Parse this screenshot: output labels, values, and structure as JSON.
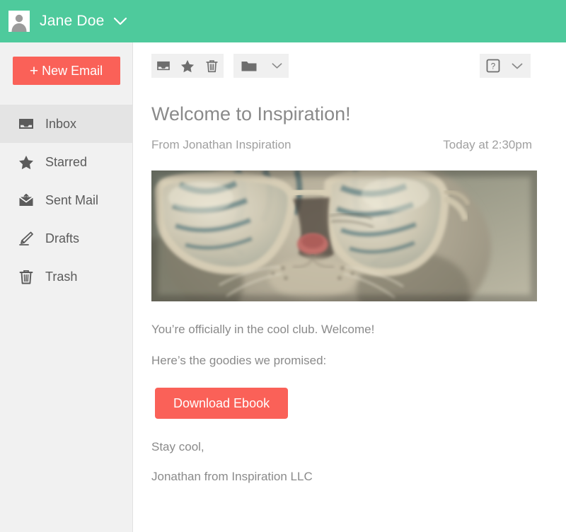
{
  "topbar": {
    "user_name": "Jane Doe",
    "avatar_icon": "person-placeholder-icon",
    "caret_icon": "chevron-down-icon",
    "background_color": "#4ECA9C"
  },
  "sidebar": {
    "new_email_label": "New Email",
    "new_email_plus": "+",
    "new_email_color": "#FA6158",
    "background_color": "#F1F1F1",
    "active_color": "#E4E4E4",
    "items": [
      {
        "label": "Inbox",
        "icon": "inbox-icon",
        "active": true
      },
      {
        "label": "Starred",
        "icon": "star-icon",
        "active": false
      },
      {
        "label": "Sent Mail",
        "icon": "sent-mail-icon",
        "active": false
      },
      {
        "label": "Drafts",
        "icon": "pencil-icon",
        "active": false
      },
      {
        "label": "Trash",
        "icon": "trash-icon",
        "active": false
      }
    ]
  },
  "toolbar": {
    "left_group": [
      {
        "icon": "archive-icon",
        "label": "Archive"
      },
      {
        "icon": "star-icon",
        "label": "Star"
      },
      {
        "icon": "trash-icon",
        "label": "Delete"
      }
    ],
    "folder_group": [
      {
        "icon": "folder-icon",
        "label": "Move to folder"
      },
      {
        "icon": "chevron-down-icon",
        "label": "Folder options"
      }
    ],
    "right_group": [
      {
        "icon": "help-icon",
        "label": "Help"
      },
      {
        "icon": "chevron-down-icon",
        "label": "More options"
      }
    ]
  },
  "email": {
    "subject": "Welcome to Inspiration!",
    "from": "From Jonathan Inspiration",
    "date": "Today at 2:30pm",
    "hero_image_alt": "cat-wearing-glasses-photo",
    "paragraph_1": "You’re officially in the cool club. Welcome!",
    "paragraph_2": "Here’s the goodies we promised:",
    "cta_label": "Download Ebook",
    "cta_color": "#FA6158",
    "signoff": "Stay cool,",
    "signature": "Jonathan from Inspiration LLC"
  }
}
